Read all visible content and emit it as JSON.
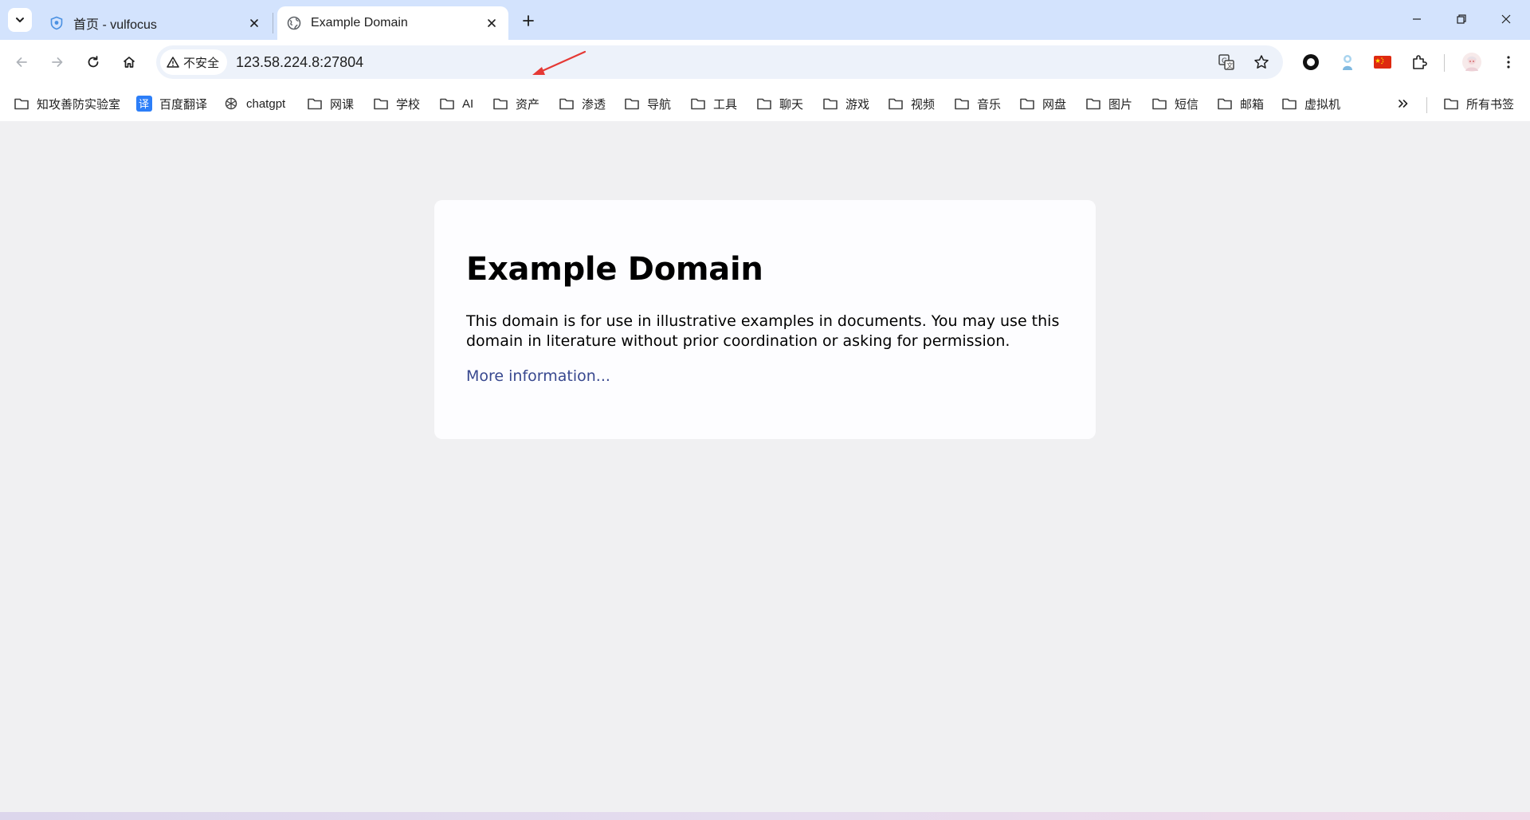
{
  "tabs": [
    {
      "title": "首页 - vulfocus",
      "active": false,
      "favicon": "shield-icon"
    },
    {
      "title": "Example Domain",
      "active": true,
      "favicon": "globe-icon"
    }
  ],
  "omnibox": {
    "security_label": "不安全",
    "url": "123.58.224.8:27804"
  },
  "bookmarks": [
    {
      "label": "知攻善防实验室",
      "icon": "folder-icon"
    },
    {
      "label": "百度翻译",
      "icon": "translate-icon"
    },
    {
      "label": "chatgpt",
      "icon": "openai-icon"
    },
    {
      "label": "网课",
      "icon": "folder-icon"
    },
    {
      "label": "学校",
      "icon": "folder-icon"
    },
    {
      "label": "AI",
      "icon": "folder-icon"
    },
    {
      "label": "资产",
      "icon": "folder-icon"
    },
    {
      "label": "渗透",
      "icon": "folder-icon"
    },
    {
      "label": "导航",
      "icon": "folder-icon"
    },
    {
      "label": "工具",
      "icon": "folder-icon"
    },
    {
      "label": "聊天",
      "icon": "folder-icon"
    },
    {
      "label": "游戏",
      "icon": "folder-icon"
    },
    {
      "label": "视频",
      "icon": "folder-icon"
    },
    {
      "label": "音乐",
      "icon": "folder-icon"
    },
    {
      "label": "网盘",
      "icon": "folder-icon"
    },
    {
      "label": "图片",
      "icon": "folder-icon"
    },
    {
      "label": "短信",
      "icon": "folder-icon"
    },
    {
      "label": "邮箱",
      "icon": "folder-icon"
    },
    {
      "label": "虚拟机",
      "icon": "folder-icon"
    }
  ],
  "all_bookmarks_label": "所有书签",
  "page": {
    "heading": "Example Domain",
    "paragraph": "This domain is for use in illustrative examples in documents. You may use this domain in literature without prior coordination or asking for permission.",
    "link": "More information..."
  },
  "colors": {
    "tabstrip": "#d3e3fd",
    "page_background": "#f0f0f2",
    "card_background": "#fdfdff",
    "link": "#38488f",
    "annotation_arrow": "#e53935"
  }
}
